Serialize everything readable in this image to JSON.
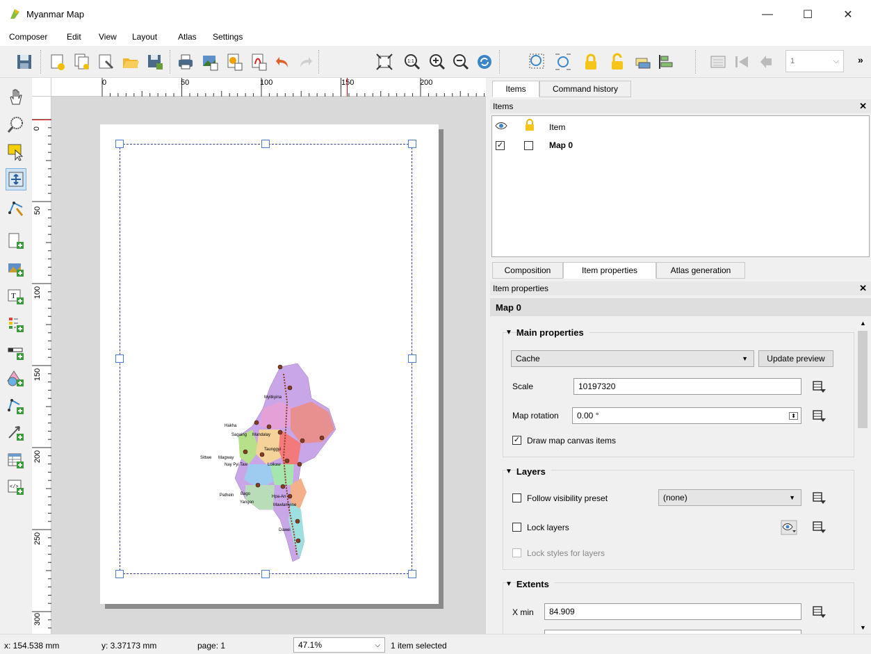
{
  "window": {
    "title": "Myanmar Map",
    "minimize": "—",
    "maximize": "☐",
    "close": "✕"
  },
  "menu": [
    "Composer",
    "Edit",
    "View",
    "Layout",
    "Atlas",
    "Settings"
  ],
  "toolbar": {
    "atlas_page": "1",
    "overflow": "»"
  },
  "ruler": {
    "h_labels": [
      "0",
      "50",
      "100",
      "150",
      "200"
    ],
    "v_labels": [
      "0",
      "50",
      "100",
      "150",
      "200",
      "250",
      "300"
    ]
  },
  "map_labels": {
    "myitkyina": "Myitkyina",
    "sagaing": "Sagaing",
    "mandalay": "Mandalay",
    "taunggyi": "Taunggyi",
    "sittwe": "Sittwe",
    "magway": "Magway",
    "naypyitaw": "Nay Pyi Taw",
    "loikaw": "Loikaw",
    "pathein": "Pathein",
    "yangon": "Yangon",
    "hpa_an": "Hpa-An",
    "mawlamyine": "Mawlamyine",
    "dawei": "Dawei",
    "bago": "Bago",
    "hakha": "Hakha"
  },
  "tabs_top": {
    "items": "Items",
    "history": "Command history"
  },
  "items_panel": {
    "header": "Items",
    "col_item": "Item",
    "rows": [
      {
        "label": "Map 0",
        "visible": true,
        "locked": false
      }
    ]
  },
  "tabs_bottom": {
    "composition": "Composition",
    "item_properties": "Item properties",
    "atlas": "Atlas generation"
  },
  "props_panel": {
    "header": "Item properties",
    "item_name": "Map 0",
    "main": {
      "title": "Main properties",
      "cache_mode": "Cache",
      "update_preview": "Update preview",
      "scale_label": "Scale",
      "scale_value": "10197320",
      "rotation_label": "Map rotation",
      "rotation_value": "0.00 °",
      "draw_canvas_items": "Draw map canvas items"
    },
    "layers": {
      "title": "Layers",
      "follow_preset": "Follow visibility preset",
      "preset_value": "(none)",
      "lock_layers": "Lock layers",
      "lock_styles": "Lock styles for layers"
    },
    "extents": {
      "title": "Extents",
      "xmin_label": "X min",
      "xmin_value": "84.909"
    }
  },
  "status": {
    "x": "x: 154.538 mm",
    "y": "y: 3.37173 mm",
    "page": "page: 1",
    "zoom": "47.1%",
    "selection": "1 item selected"
  }
}
